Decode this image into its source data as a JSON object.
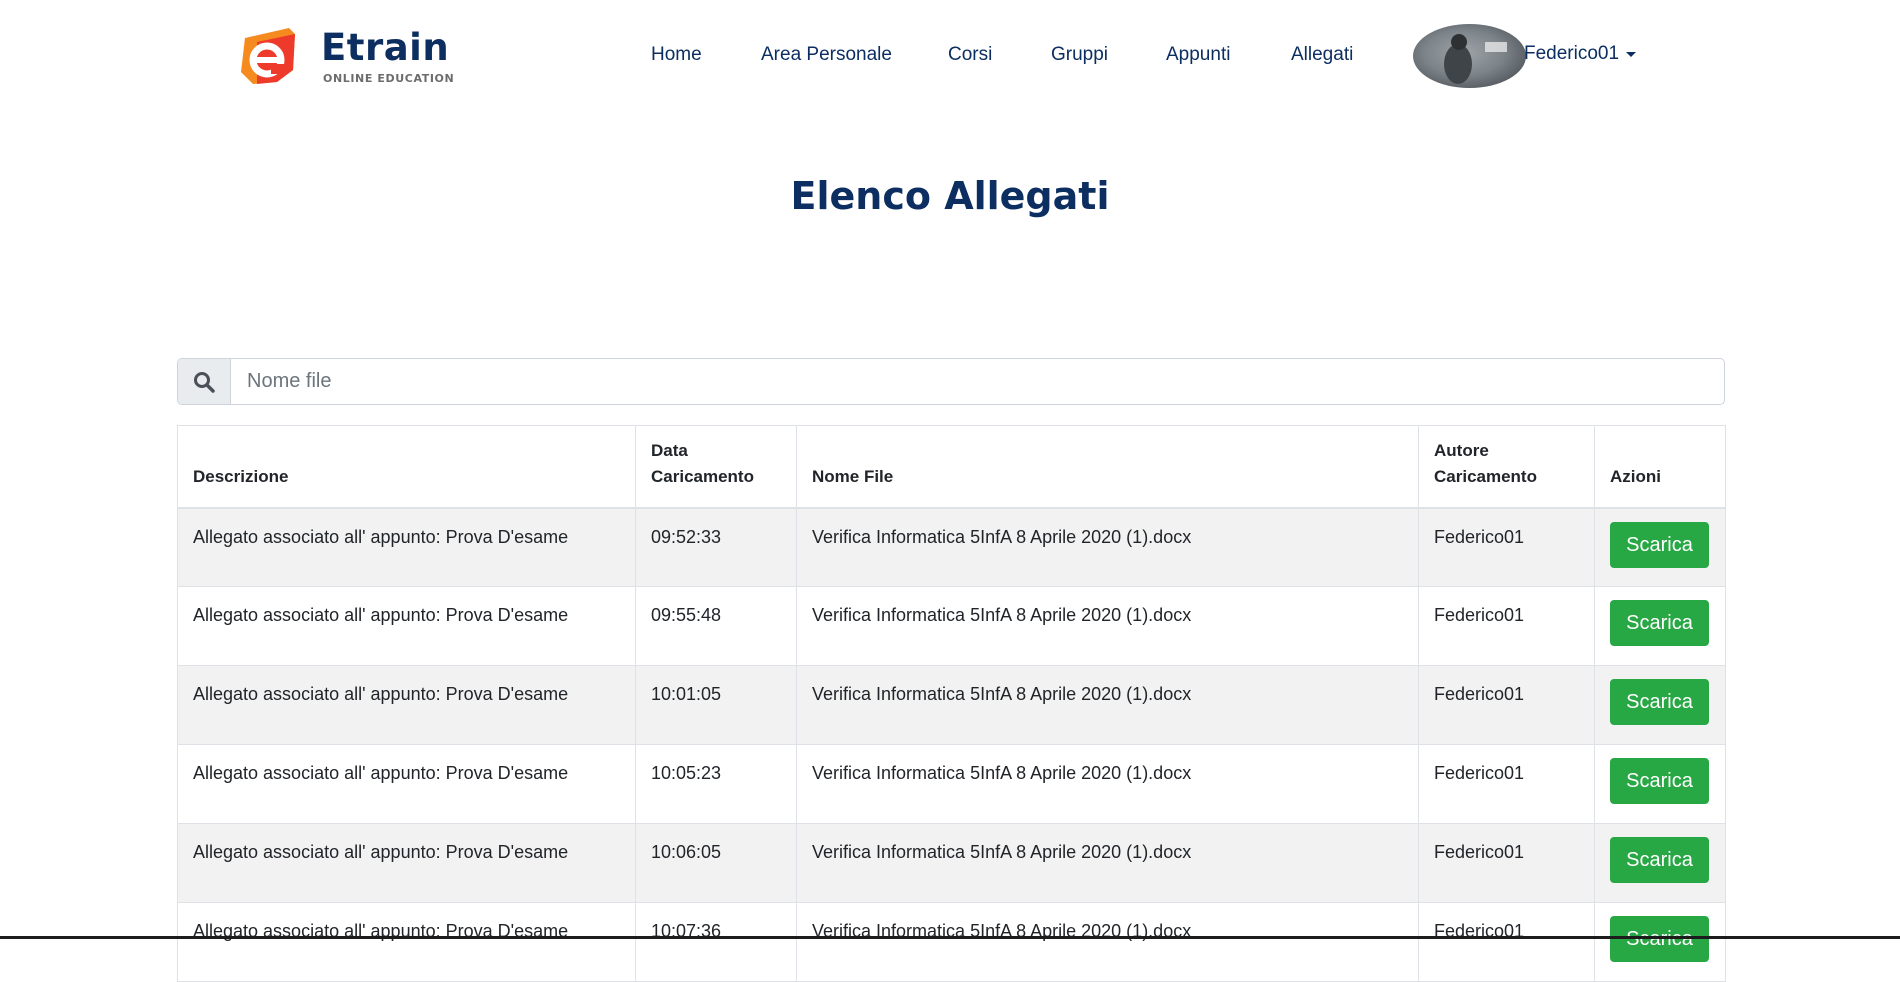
{
  "brand": {
    "name": "Etrain",
    "tagline": "ONLINE EDUCATION",
    "colors": {
      "orange": "#f58a1f",
      "red": "#ee3a2b",
      "navy": "#0c2e60"
    }
  },
  "nav": {
    "items": [
      {
        "label": "Home"
      },
      {
        "label": "Area Personale"
      },
      {
        "label": "Corsi"
      },
      {
        "label": "Gruppi"
      },
      {
        "label": "Appunti"
      },
      {
        "label": "Allegati"
      }
    ],
    "user": {
      "name": "Federico01",
      "avatar_icon": "user-avatar-photo",
      "dropdown_icon": "caret-down-icon"
    }
  },
  "page": {
    "title": "Elenco Allegati"
  },
  "search": {
    "placeholder": "Nome file",
    "value": "",
    "icon": "search-icon"
  },
  "table": {
    "headers": {
      "descrizione": "Descrizione",
      "data_1": "Data",
      "data_2": "Caricamento",
      "nome_file": "Nome File",
      "autore_1": "Autore",
      "autore_2": "Caricamento",
      "azioni": "Azioni"
    },
    "rows": [
      {
        "descrizione": "Allegato associato all' appunto: Prova D'esame",
        "data": "09:52:33",
        "nome_file": "Verifica Informatica 5InfA 8 Aprile 2020 (1).docx",
        "autore": "Federico01",
        "azione": "Scarica"
      },
      {
        "descrizione": "Allegato associato all' appunto: Prova D'esame",
        "data": "09:55:48",
        "nome_file": "Verifica Informatica 5InfA 8 Aprile 2020 (1).docx",
        "autore": "Federico01",
        "azione": "Scarica"
      },
      {
        "descrizione": "Allegato associato all' appunto: Prova D'esame",
        "data": "10:01:05",
        "nome_file": "Verifica Informatica 5InfA 8 Aprile 2020 (1).docx",
        "autore": "Federico01",
        "azione": "Scarica"
      },
      {
        "descrizione": "Allegato associato all' appunto: Prova D'esame",
        "data": "10:05:23",
        "nome_file": "Verifica Informatica 5InfA 8 Aprile 2020 (1).docx",
        "autore": "Federico01",
        "azione": "Scarica"
      },
      {
        "descrizione": "Allegato associato all' appunto: Prova D'esame",
        "data": "10:06:05",
        "nome_file": "Verifica Informatica 5InfA 8 Aprile 2020 (1).docx",
        "autore": "Federico01",
        "azione": "Scarica"
      },
      {
        "descrizione": "Allegato associato all' appunto: Prova D'esame",
        "data": "10:07:36",
        "nome_file": "Verifica Informatica 5InfA 8 Aprile 2020 (1).docx",
        "autore": "Federico01",
        "azione": "Scarica"
      }
    ]
  }
}
